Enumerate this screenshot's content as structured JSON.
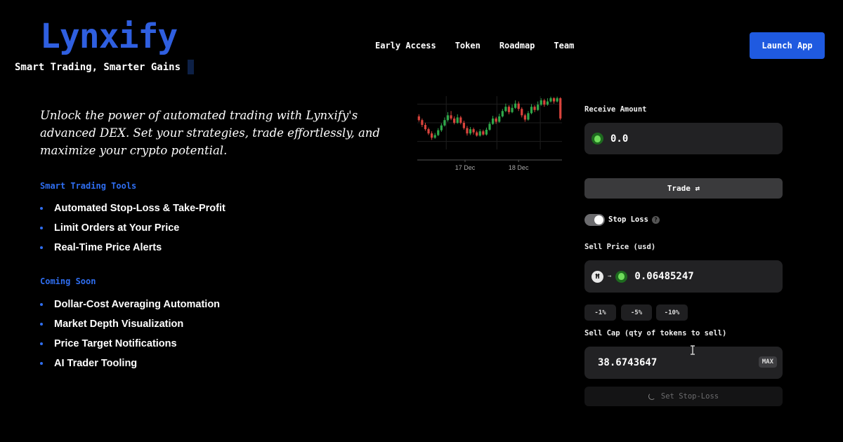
{
  "brand": {
    "name": "Lynxify",
    "tagline": "Smart Trading, Smarter Gains"
  },
  "nav": {
    "items": [
      "Early Access",
      "Token",
      "Roadmap",
      "Team"
    ],
    "cta": "Launch App"
  },
  "hero": {
    "intro": "Unlock the power of automated trading with Lynxify's advanced DEX. Set your strategies, trade effortlessly, and maximize your crypto potential.",
    "sections": [
      {
        "title": "Smart Trading Tools",
        "items": [
          "Automated Stop-Loss & Take-Profit",
          "Limit Orders at Your Price",
          "Real-Time Price Alerts"
        ]
      },
      {
        "title": "Coming Soon",
        "items": [
          "Dollar-Cost Averaging Automation",
          "Market Depth Visualization",
          "Price Target Notifications",
          "AI Trader Tooling"
        ]
      }
    ]
  },
  "chart_data": {
    "type": "candlestick",
    "x_tick_labels": [
      "17 Dec",
      "18 Dec"
    ],
    "candles": [
      {
        "o": 0.62,
        "c": 0.55,
        "h": 0.66,
        "l": 0.52
      },
      {
        "o": 0.55,
        "c": 0.46,
        "h": 0.58,
        "l": 0.42
      },
      {
        "o": 0.46,
        "c": 0.38,
        "h": 0.5,
        "l": 0.35
      },
      {
        "o": 0.38,
        "c": 0.3,
        "h": 0.41,
        "l": 0.27
      },
      {
        "o": 0.3,
        "c": 0.22,
        "h": 0.34,
        "l": 0.18
      },
      {
        "o": 0.22,
        "c": 0.27,
        "h": 0.31,
        "l": 0.2
      },
      {
        "o": 0.27,
        "c": 0.36,
        "h": 0.4,
        "l": 0.25
      },
      {
        "o": 0.36,
        "c": 0.45,
        "h": 0.49,
        "l": 0.33
      },
      {
        "o": 0.45,
        "c": 0.55,
        "h": 0.6,
        "l": 0.43
      },
      {
        "o": 0.55,
        "c": 0.64,
        "h": 0.7,
        "l": 0.52
      },
      {
        "o": 0.64,
        "c": 0.58,
        "h": 0.72,
        "l": 0.55
      },
      {
        "o": 0.58,
        "c": 0.5,
        "h": 0.62,
        "l": 0.47
      },
      {
        "o": 0.5,
        "c": 0.6,
        "h": 0.66,
        "l": 0.48
      },
      {
        "o": 0.6,
        "c": 0.5,
        "h": 0.63,
        "l": 0.47
      },
      {
        "o": 0.5,
        "c": 0.4,
        "h": 0.54,
        "l": 0.37
      },
      {
        "o": 0.4,
        "c": 0.3,
        "h": 0.44,
        "l": 0.26
      },
      {
        "o": 0.3,
        "c": 0.38,
        "h": 0.42,
        "l": 0.27
      },
      {
        "o": 0.38,
        "c": 0.32,
        "h": 0.41,
        "l": 0.28
      },
      {
        "o": 0.32,
        "c": 0.26,
        "h": 0.35,
        "l": 0.24
      },
      {
        "o": 0.26,
        "c": 0.34,
        "h": 0.38,
        "l": 0.24
      },
      {
        "o": 0.34,
        "c": 0.28,
        "h": 0.37,
        "l": 0.26
      },
      {
        "o": 0.28,
        "c": 0.37,
        "h": 0.41,
        "l": 0.26
      },
      {
        "o": 0.37,
        "c": 0.48,
        "h": 0.52,
        "l": 0.35
      },
      {
        "o": 0.48,
        "c": 0.58,
        "h": 0.63,
        "l": 0.46
      },
      {
        "o": 0.58,
        "c": 0.52,
        "h": 0.61,
        "l": 0.48
      },
      {
        "o": 0.52,
        "c": 0.62,
        "h": 0.67,
        "l": 0.5
      },
      {
        "o": 0.62,
        "c": 0.72,
        "h": 0.76,
        "l": 0.6
      },
      {
        "o": 0.72,
        "c": 0.8,
        "h": 0.86,
        "l": 0.7
      },
      {
        "o": 0.8,
        "c": 0.7,
        "h": 0.83,
        "l": 0.66
      },
      {
        "o": 0.7,
        "c": 0.78,
        "h": 0.84,
        "l": 0.68
      },
      {
        "o": 0.78,
        "c": 0.86,
        "h": 0.92,
        "l": 0.76
      },
      {
        "o": 0.86,
        "c": 0.76,
        "h": 0.9,
        "l": 0.72
      },
      {
        "o": 0.76,
        "c": 0.64,
        "h": 0.79,
        "l": 0.6
      },
      {
        "o": 0.64,
        "c": 0.56,
        "h": 0.67,
        "l": 0.52
      },
      {
        "o": 0.56,
        "c": 0.68,
        "h": 0.72,
        "l": 0.54
      },
      {
        "o": 0.68,
        "c": 0.8,
        "h": 0.85,
        "l": 0.66
      },
      {
        "o": 0.8,
        "c": 0.74,
        "h": 0.83,
        "l": 0.7
      },
      {
        "o": 0.74,
        "c": 0.84,
        "h": 0.9,
        "l": 0.72
      },
      {
        "o": 0.84,
        "c": 0.92,
        "h": 0.96,
        "l": 0.82
      },
      {
        "o": 0.92,
        "c": 0.84,
        "h": 0.95,
        "l": 0.8
      },
      {
        "o": 0.84,
        "c": 0.9,
        "h": 0.96,
        "l": 0.82
      },
      {
        "o": 0.9,
        "c": 0.96,
        "h": 0.99,
        "l": 0.88
      },
      {
        "o": 0.96,
        "c": 0.9,
        "h": 0.98,
        "l": 0.86
      },
      {
        "o": 0.9,
        "c": 0.96,
        "h": 0.99,
        "l": 0.88
      },
      {
        "o": 0.96,
        "c": 0.58,
        "h": 0.98,
        "l": 0.55
      }
    ],
    "colors": {
      "up": "#2fa84a",
      "down": "#d9433c"
    }
  },
  "panel": {
    "receive_label": "Receive Amount",
    "receive_value": "0.0",
    "trade_button": "Trade ⇄",
    "stop_loss_label": "Stop Loss",
    "stop_loss_enabled": true,
    "help_icon": "?",
    "sell_price_label": "Sell Price (usd)",
    "hbar_icon": "Ħ",
    "arrow_icon": "→",
    "sell_price_value": "0.06485247",
    "pct_buttons": [
      "-1%",
      "-5%",
      "-10%"
    ],
    "sell_cap_label": "Sell Cap (qty of tokens to sell)",
    "sell_cap_value": "38.6743647",
    "max_button": "MAX",
    "set_button": "Set Stop-Loss"
  },
  "colors": {
    "brand": "#2f5fe0",
    "accent": "#2f6ef0",
    "cta": "#1f5ae0"
  }
}
